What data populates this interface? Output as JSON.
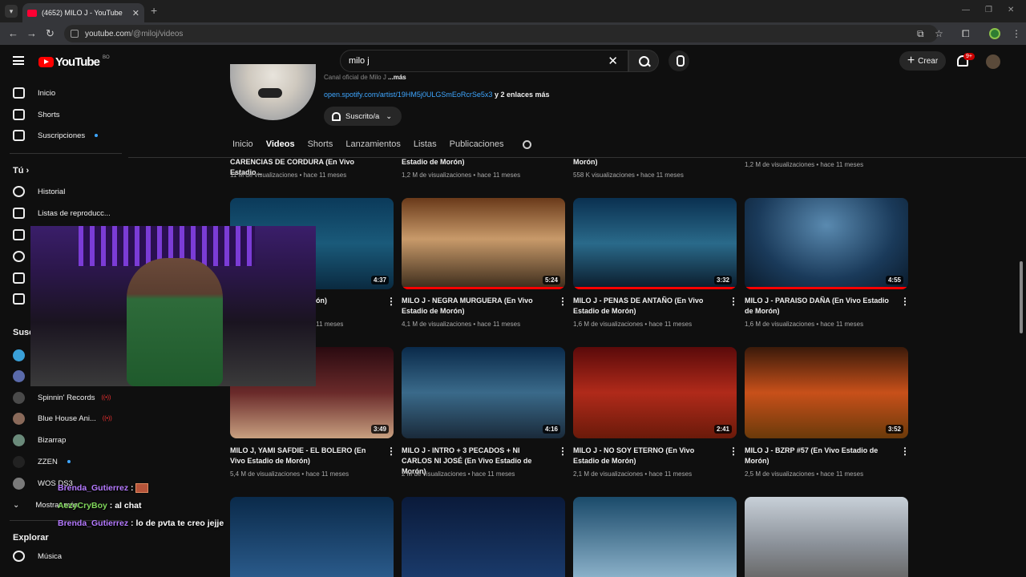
{
  "browser": {
    "tab_title": "(4652) MILO J - YouTube",
    "url_domain": "youtube.com",
    "url_path": "/@miloj/videos"
  },
  "header": {
    "logo_text": "YouTube",
    "region": "BO",
    "search_value": "milo j",
    "create_label": "Crear",
    "notif_count": "9+"
  },
  "sidebar": {
    "items": [
      {
        "label": "Inicio",
        "icon": "home-icon"
      },
      {
        "label": "Shorts",
        "icon": "shorts-icon"
      },
      {
        "label": "Suscripciones",
        "icon": "subscriptions-icon"
      }
    ],
    "you_label": "Tú",
    "you_items": [
      {
        "label": "Historial",
        "icon": "history-icon"
      },
      {
        "label": "Listas de reproducc...",
        "icon": "playlist-icon"
      }
    ],
    "subs_label": "Susc",
    "channels": [
      {
        "label": "Spinnin' Records",
        "color": "#4a4a4a"
      },
      {
        "label": "Blue House Ani...",
        "color": "#8a6a5a"
      },
      {
        "label": "Bizarrap",
        "color": "#6a8a7a"
      },
      {
        "label": "ZZEN",
        "color": "#222222"
      },
      {
        "label": "WOS DS3",
        "color": "#7a7a7a"
      }
    ],
    "show_more": "Mostrar más",
    "explore_label": "Explorar",
    "explore_items": [
      {
        "label": "Música",
        "icon": "music-icon"
      }
    ]
  },
  "channel": {
    "desc": "Canal oficial de Milo J",
    "desc_more": "...más",
    "link": "open.spotify.com/artist/19HM5j0ULGSmEoRcrSe5x3",
    "link_more": "y 2 enlaces más",
    "sub_label": "Suscrito/a",
    "tabs": [
      "Inicio",
      "Videos",
      "Shorts",
      "Lanzamientos",
      "Listas",
      "Publicaciones"
    ]
  },
  "row0": [
    {
      "title": "CARENCIAS DE CORDURA (En Vivo Estadio...",
      "meta": "11 M de visualizaciones • hace 11 meses"
    },
    {
      "title": "Estadio de Morón)",
      "meta": "1,2 M de visualizaciones • hace 11 meses"
    },
    {
      "title": "Morón)",
      "meta": "558 K visualizaciones • hace 11 meses"
    },
    {
      "title": "",
      "meta": "1,2 M de visualizaciones • hace 11 meses"
    }
  ],
  "row1": [
    {
      "title": "ANCIÓN PARA MI de Morón)",
      "meta": "1 M de visualizaciones • hace 11 meses",
      "dur": "4:37"
    },
    {
      "title": "MILO J - NEGRA MURGUERA (En Vivo Estadio de Morón)",
      "meta": "4,1 M de visualizaciones • hace 11 meses",
      "dur": "5:24"
    },
    {
      "title": "MILO J - PENAS DE ANTAÑO (En Vivo Estadio de Morón)",
      "meta": "1,6 M de visualizaciones • hace 11 meses",
      "dur": "3:32"
    },
    {
      "title": "MILO J - PARAISO DAÑA (En Vivo Estadio de Morón)",
      "meta": "1,6 M de visualizaciones • hace 11 meses",
      "dur": "4:55"
    }
  ],
  "row2": [
    {
      "title": "MILO J, YAMI SAFDIE - EL BOLERO (En Vivo Estadio de Morón)",
      "meta": "5,4 M de visualizaciones • hace 11 meses",
      "dur": "3:49"
    },
    {
      "title": "MILO J - INTRO + 3 PECADOS + NI CARLOS NI JOSÉ (En Vivo Estadio de Morón)",
      "meta": "2 M de visualizaciones • hace 11 meses",
      "dur": "4:16"
    },
    {
      "title": "MILO J - NO SOY ETERNO (En Vivo Estadio de Morón)",
      "meta": "2,1 M de visualizaciones • hace 11 meses",
      "dur": "2:41"
    },
    {
      "title": "MILO J - BZRP #57 (En Vivo Estadio de Morón)",
      "meta": "2,5 M de visualizaciones • hace 11 meses",
      "dur": "3:52"
    }
  ],
  "chat": [
    {
      "user": "Brenda_Gutierrez",
      "msg": "",
      "emote": true
    },
    {
      "user": "AezyCryBoy",
      "msg": "al chat",
      "emote": false
    },
    {
      "user": "Brenda_Gutierrez",
      "msg": "lo de pvta te creo jejje",
      "emote": false
    }
  ]
}
